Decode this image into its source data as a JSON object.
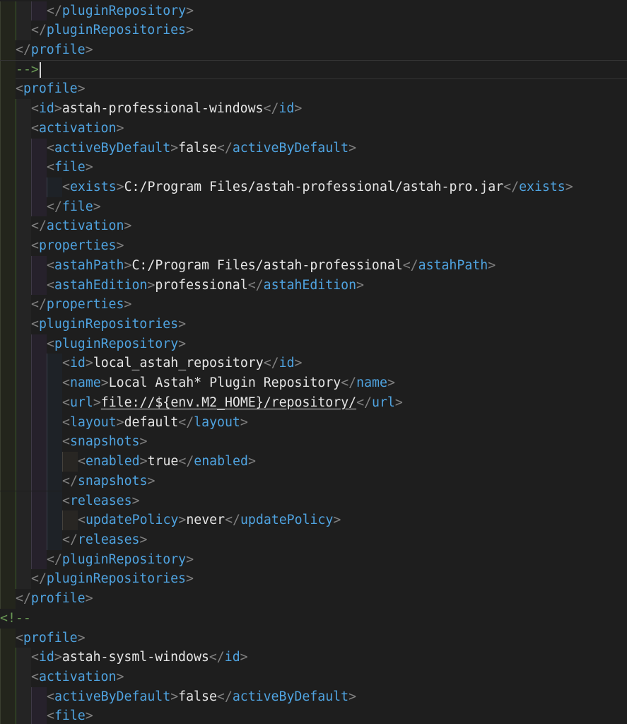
{
  "lines": [
    {
      "segments": [
        {
          "t": "</",
          "c": "br"
        },
        {
          "t": "pluginRepository",
          "c": "tag"
        },
        {
          "t": ">",
          "c": "br"
        }
      ]
    },
    {
      "segments": [
        {
          "t": "</",
          "c": "br"
        },
        {
          "t": "pluginRepositories",
          "c": "tag"
        },
        {
          "t": ">",
          "c": "br"
        }
      ]
    },
    {
      "segments": [
        {
          "t": "</",
          "c": "br"
        },
        {
          "t": "profile",
          "c": "tag"
        },
        {
          "t": ">",
          "c": "br"
        }
      ]
    },
    {
      "segments": [
        {
          "t": "-->",
          "c": "cm"
        }
      ],
      "cursor": true
    },
    {
      "segments": [
        {
          "t": "<",
          "c": "br"
        },
        {
          "t": "profile",
          "c": "tag"
        },
        {
          "t": ">",
          "c": "br"
        }
      ]
    },
    {
      "segments": [
        {
          "t": "<",
          "c": "br"
        },
        {
          "t": "id",
          "c": "tag"
        },
        {
          "t": ">",
          "c": "br"
        },
        {
          "t": "astah-professional-windows",
          "c": "txt"
        },
        {
          "t": "</",
          "c": "br"
        },
        {
          "t": "id",
          "c": "tag"
        },
        {
          "t": ">",
          "c": "br"
        }
      ]
    },
    {
      "segments": [
        {
          "t": "<",
          "c": "br"
        },
        {
          "t": "activation",
          "c": "tag"
        },
        {
          "t": ">",
          "c": "br"
        }
      ]
    },
    {
      "segments": [
        {
          "t": "<",
          "c": "br"
        },
        {
          "t": "activeByDefault",
          "c": "tag"
        },
        {
          "t": ">",
          "c": "br"
        },
        {
          "t": "false",
          "c": "txt"
        },
        {
          "t": "</",
          "c": "br"
        },
        {
          "t": "activeByDefault",
          "c": "tag"
        },
        {
          "t": ">",
          "c": "br"
        }
      ]
    },
    {
      "segments": [
        {
          "t": "<",
          "c": "br"
        },
        {
          "t": "file",
          "c": "tag"
        },
        {
          "t": ">",
          "c": "br"
        }
      ]
    },
    {
      "segments": [
        {
          "t": "<",
          "c": "br"
        },
        {
          "t": "exists",
          "c": "tag"
        },
        {
          "t": ">",
          "c": "br"
        },
        {
          "t": "C:/Program Files/astah-professional/astah-pro.jar",
          "c": "txt"
        },
        {
          "t": "</",
          "c": "br"
        },
        {
          "t": "exists",
          "c": "tag"
        },
        {
          "t": ">",
          "c": "br"
        }
      ]
    },
    {
      "segments": [
        {
          "t": "</",
          "c": "br"
        },
        {
          "t": "file",
          "c": "tag"
        },
        {
          "t": ">",
          "c": "br"
        }
      ]
    },
    {
      "segments": [
        {
          "t": "</",
          "c": "br"
        },
        {
          "t": "activation",
          "c": "tag"
        },
        {
          "t": ">",
          "c": "br"
        }
      ]
    },
    {
      "segments": [
        {
          "t": "<",
          "c": "br"
        },
        {
          "t": "properties",
          "c": "tag"
        },
        {
          "t": ">",
          "c": "br"
        }
      ]
    },
    {
      "segments": [
        {
          "t": "<",
          "c": "br"
        },
        {
          "t": "astahPath",
          "c": "tag"
        },
        {
          "t": ">",
          "c": "br"
        },
        {
          "t": "C:/Program Files/astah-professional",
          "c": "txt"
        },
        {
          "t": "</",
          "c": "br"
        },
        {
          "t": "astahPath",
          "c": "tag"
        },
        {
          "t": ">",
          "c": "br"
        }
      ]
    },
    {
      "segments": [
        {
          "t": "<",
          "c": "br"
        },
        {
          "t": "astahEdition",
          "c": "tag"
        },
        {
          "t": ">",
          "c": "br"
        },
        {
          "t": "professional",
          "c": "txt"
        },
        {
          "t": "</",
          "c": "br"
        },
        {
          "t": "astahEdition",
          "c": "tag"
        },
        {
          "t": ">",
          "c": "br"
        }
      ]
    },
    {
      "segments": [
        {
          "t": "</",
          "c": "br"
        },
        {
          "t": "properties",
          "c": "tag"
        },
        {
          "t": ">",
          "c": "br"
        }
      ]
    },
    {
      "segments": [
        {
          "t": "<",
          "c": "br"
        },
        {
          "t": "pluginRepositories",
          "c": "tag"
        },
        {
          "t": ">",
          "c": "br"
        }
      ]
    },
    {
      "segments": [
        {
          "t": "<",
          "c": "br"
        },
        {
          "t": "pluginRepository",
          "c": "tag"
        },
        {
          "t": ">",
          "c": "br"
        }
      ]
    },
    {
      "segments": [
        {
          "t": "<",
          "c": "br"
        },
        {
          "t": "id",
          "c": "tag"
        },
        {
          "t": ">",
          "c": "br"
        },
        {
          "t": "local_astah_repository",
          "c": "txt"
        },
        {
          "t": "</",
          "c": "br"
        },
        {
          "t": "id",
          "c": "tag"
        },
        {
          "t": ">",
          "c": "br"
        }
      ]
    },
    {
      "segments": [
        {
          "t": "<",
          "c": "br"
        },
        {
          "t": "name",
          "c": "tag"
        },
        {
          "t": ">",
          "c": "br"
        },
        {
          "t": "Local Astah* Plugin Repository",
          "c": "txt"
        },
        {
          "t": "</",
          "c": "br"
        },
        {
          "t": "name",
          "c": "tag"
        },
        {
          "t": ">",
          "c": "br"
        }
      ]
    },
    {
      "segments": [
        {
          "t": "<",
          "c": "br"
        },
        {
          "t": "url",
          "c": "tag"
        },
        {
          "t": ">",
          "c": "br"
        },
        {
          "t": "file://${env.M2_HOME}/repository/",
          "c": "link"
        },
        {
          "t": "</",
          "c": "br"
        },
        {
          "t": "url",
          "c": "tag"
        },
        {
          "t": ">",
          "c": "br"
        }
      ]
    },
    {
      "segments": [
        {
          "t": "<",
          "c": "br"
        },
        {
          "t": "layout",
          "c": "tag"
        },
        {
          "t": ">",
          "c": "br"
        },
        {
          "t": "default",
          "c": "txt"
        },
        {
          "t": "</",
          "c": "br"
        },
        {
          "t": "layout",
          "c": "tag"
        },
        {
          "t": ">",
          "c": "br"
        }
      ]
    },
    {
      "segments": [
        {
          "t": "<",
          "c": "br"
        },
        {
          "t": "snapshots",
          "c": "tag"
        },
        {
          "t": ">",
          "c": "br"
        }
      ]
    },
    {
      "segments": [
        {
          "t": "<",
          "c": "br"
        },
        {
          "t": "enabled",
          "c": "tag"
        },
        {
          "t": ">",
          "c": "br"
        },
        {
          "t": "true",
          "c": "txt"
        },
        {
          "t": "</",
          "c": "br"
        },
        {
          "t": "enabled",
          "c": "tag"
        },
        {
          "t": ">",
          "c": "br"
        }
      ]
    },
    {
      "segments": [
        {
          "t": "</",
          "c": "br"
        },
        {
          "t": "snapshots",
          "c": "tag"
        },
        {
          "t": ">",
          "c": "br"
        }
      ]
    },
    {
      "segments": [
        {
          "t": "<",
          "c": "br"
        },
        {
          "t": "releases",
          "c": "tag"
        },
        {
          "t": ">",
          "c": "br"
        }
      ]
    },
    {
      "segments": [
        {
          "t": "<",
          "c": "br"
        },
        {
          "t": "updatePolicy",
          "c": "tag"
        },
        {
          "t": ">",
          "c": "br"
        },
        {
          "t": "never",
          "c": "txt"
        },
        {
          "t": "</",
          "c": "br"
        },
        {
          "t": "updatePolicy",
          "c": "tag"
        },
        {
          "t": ">",
          "c": "br"
        }
      ]
    },
    {
      "segments": [
        {
          "t": "</",
          "c": "br"
        },
        {
          "t": "releases",
          "c": "tag"
        },
        {
          "t": ">",
          "c": "br"
        }
      ]
    },
    {
      "segments": [
        {
          "t": "</",
          "c": "br"
        },
        {
          "t": "pluginRepository",
          "c": "tag"
        },
        {
          "t": ">",
          "c": "br"
        }
      ]
    },
    {
      "segments": [
        {
          "t": "</",
          "c": "br"
        },
        {
          "t": "pluginRepositories",
          "c": "tag"
        },
        {
          "t": ">",
          "c": "br"
        }
      ]
    },
    {
      "segments": [
        {
          "t": "</",
          "c": "br"
        },
        {
          "t": "profile",
          "c": "tag"
        },
        {
          "t": ">",
          "c": "br"
        }
      ]
    },
    {
      "segments": [
        {
          "t": "<!--",
          "c": "cm"
        }
      ]
    },
    {
      "segments": [
        {
          "t": "<",
          "c": "br"
        },
        {
          "t": "profile",
          "c": "tag"
        },
        {
          "t": ">",
          "c": "br"
        }
      ]
    },
    {
      "segments": [
        {
          "t": "<",
          "c": "br"
        },
        {
          "t": "id",
          "c": "tag"
        },
        {
          "t": ">",
          "c": "br"
        },
        {
          "t": "astah-sysml-windows",
          "c": "txt"
        },
        {
          "t": "</",
          "c": "br"
        },
        {
          "t": "id",
          "c": "tag"
        },
        {
          "t": ">",
          "c": "br"
        }
      ]
    },
    {
      "segments": [
        {
          "t": "<",
          "c": "br"
        },
        {
          "t": "activation",
          "c": "tag"
        },
        {
          "t": ">",
          "c": "br"
        }
      ]
    },
    {
      "segments": [
        {
          "t": "<",
          "c": "br"
        },
        {
          "t": "activeByDefault",
          "c": "tag"
        },
        {
          "t": ">",
          "c": "br"
        },
        {
          "t": "false",
          "c": "txt"
        },
        {
          "t": "</",
          "c": "br"
        },
        {
          "t": "activeByDefault",
          "c": "tag"
        },
        {
          "t": ">",
          "c": "br"
        }
      ]
    },
    {
      "segments": [
        {
          "t": "<",
          "c": "br"
        },
        {
          "t": "file",
          "c": "tag"
        },
        {
          "t": ">",
          "c": "br"
        }
      ]
    }
  ]
}
